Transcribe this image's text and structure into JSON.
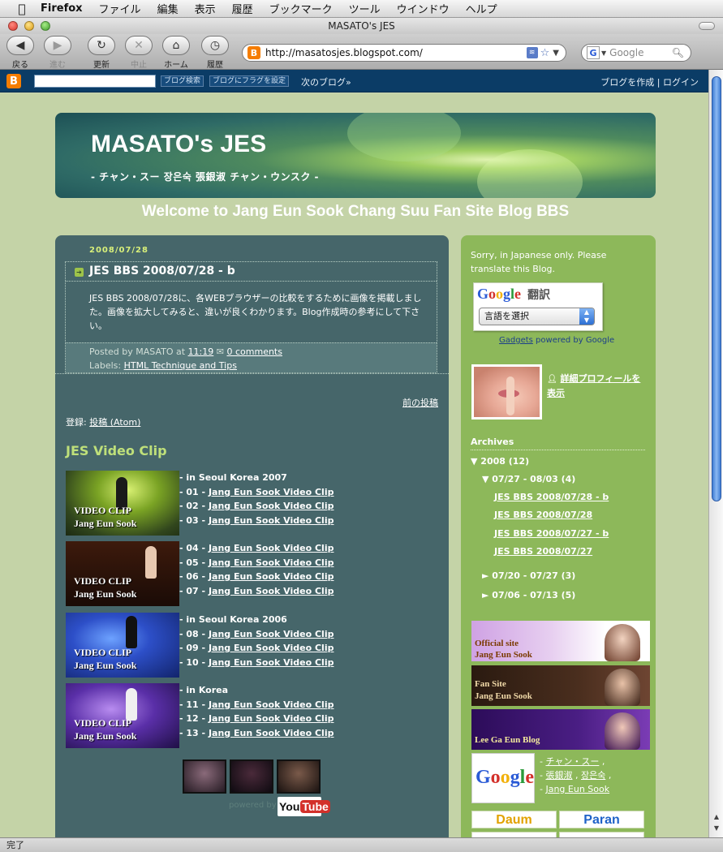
{
  "menubar": {
    "app": "Firefox",
    "items": [
      "ファイル",
      "編集",
      "表示",
      "履歴",
      "ブックマーク",
      "ツール",
      "ウインドウ",
      "ヘルプ"
    ]
  },
  "window": {
    "title": "MASATO's JES"
  },
  "toolbar": {
    "back": "戻る",
    "forward": "進む",
    "reload": "更新",
    "stop": "中止",
    "home": "ホーム",
    "history": "履歴",
    "url": "http://masatosjes.blogspot.com/",
    "search_placeholder": "Google"
  },
  "navbar": {
    "search_button": "ブログ検索",
    "flag_button": "ブログにフラグを設定",
    "next_blog": "次のブログ»",
    "create_blog": "ブログを作成",
    "separator": "|",
    "login": "ログイン"
  },
  "header": {
    "title": "MASATO's JES",
    "description": "- チャン・スー 장은숙 張銀淑 チャン・ウンスク -"
  },
  "welcome": "Welcome to Jang Eun Sook Chang Suu Fan Site Blog BBS",
  "post": {
    "date": "2008/07/28",
    "title": "JES BBS 2008/07/28 - b",
    "body": "JES BBS 2008/07/28に、各WEBブラウザーの比較をするために画像を掲載しました。画像を拡大してみると、違いが良くわかります。Blog作成時の参考にして下さい。",
    "posted_by_prefix": "Posted by MASATO at ",
    "time": "11:19",
    "comments": "0 comments",
    "labels_prefix": "Labels: ",
    "label": "HTML Technique and Tips"
  },
  "nav": {
    "older": "前の投稿",
    "subscribe_prefix": "登録: ",
    "subscribe_link": "投稿 (Atom)"
  },
  "videos": {
    "title": "JES Video Clip",
    "thumb_line1": "VIDEO CLIP",
    "thumb_line2": "Jang Eun Sook",
    "groups": [
      {
        "heading": "- in Seoul Korea 2007",
        "items": [
          {
            "num": "- 01 - ",
            "link": "Jang Eun Sook Video Clip"
          },
          {
            "num": "- 02 - ",
            "link": "Jang Eun Sook Video Clip"
          },
          {
            "num": "- 03 - ",
            "link": "Jang Eun Sook Video Clip"
          }
        ]
      },
      {
        "heading": "",
        "items": [
          {
            "num": "- 04 - ",
            "link": "Jang Eun Sook Video Clip"
          },
          {
            "num": "- 05 - ",
            "link": "Jang Eun Sook Video Clip"
          },
          {
            "num": "- 06 - ",
            "link": "Jang Eun Sook Video Clip"
          },
          {
            "num": "- 07 - ",
            "link": "Jang Eun Sook Video Clip"
          }
        ]
      },
      {
        "heading": "- in Seoul Korea 2006",
        "items": [
          {
            "num": "- 08 - ",
            "link": "Jang Eun Sook Video Clip"
          },
          {
            "num": "- 09 - ",
            "link": "Jang Eun Sook Video Clip"
          },
          {
            "num": "- 10 - ",
            "link": "Jang Eun Sook Video Clip"
          }
        ]
      },
      {
        "heading": "- in Korea",
        "items": [
          {
            "num": "- 11 - ",
            "link": "Jang Eun Sook Video Clip"
          },
          {
            "num": "- 12 - ",
            "link": "Jang Eun Sook Video Clip"
          },
          {
            "num": "- 13 - ",
            "link": "Jang Eun Sook Video Clip"
          }
        ]
      }
    ],
    "powered_by": "powered by",
    "youtube_you": "You",
    "youtube_tube": "Tube"
  },
  "sidebar": {
    "sorry": "Sorry, in Japanese only. Please translate this Blog.",
    "translate_label": "翻訳",
    "translate_select": "言語を選択",
    "gadgets": "Gadgets",
    "powered_by_google": "powered by Google",
    "profile_link": "詳細プロフィールを表示",
    "archives_title": "Archives",
    "archive_year": "▼ 2008 (12)",
    "archive_week1": "▼ 07/27 - 08/03 (4)",
    "archive_posts": [
      "JES BBS 2008/07/28 - b",
      "JES BBS 2008/07/28",
      "JES BBS 2008/07/27 - b",
      "JES BBS 2008/07/27"
    ],
    "archive_week2": "► 07/20 - 07/27 (3)",
    "archive_week3": "► 07/06 - 07/13 (5)",
    "banners": {
      "official_1": "Official site",
      "official_2": "Jang Eun Sook",
      "fansite_1": "Fan Site",
      "fansite_2": "Jang Eun Sook",
      "lee": "Lee Ga Eun Blog"
    },
    "google_terms": {
      "t1": "チャン・スー",
      "t2": "張銀淑",
      "t3": "장은숙",
      "t4": "Jang Eun Sook"
    },
    "logos": {
      "daum": "Daum",
      "paran": "Paran"
    }
  },
  "status": "完了"
}
